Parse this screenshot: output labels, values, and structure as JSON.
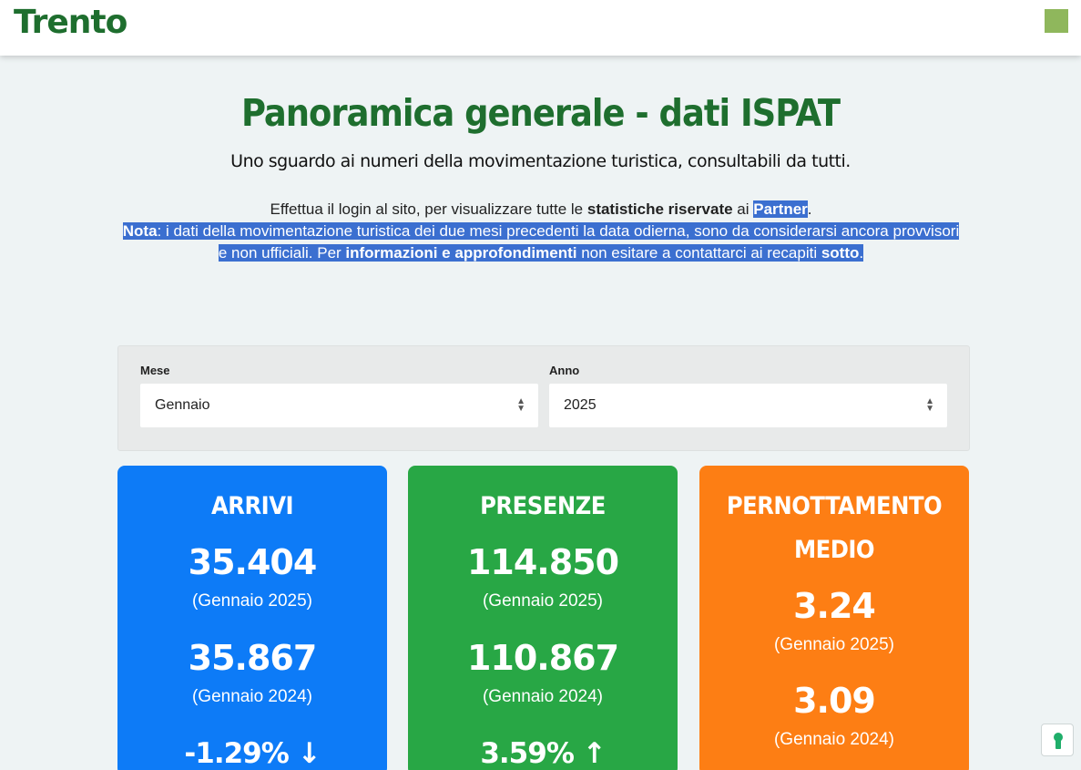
{
  "header": {
    "logo_text": "Trento",
    "menu_color": "#8fb75c"
  },
  "page": {
    "title": "Panoramica generale - dati ISPAT",
    "subtitle": "Uno sguardo ai numeri della movimentazione turistica, consultabili da tutti."
  },
  "info": {
    "line1_pre": "Effettua il login al sito, per visualizzare tutte le ",
    "line1_bold": "statistiche riservate",
    "line1_mid": " ai ",
    "line1_partner": "Partner",
    "line1_end": ".",
    "nota_label": "Nota",
    "nota_text": ": i dati della movimentazione turistica dei due mesi precedenti la data odierna, sono da considerarsi ancora provvisori e non ufficiali. Per ",
    "nota_bold": "informazioni e approfondimenti",
    "nota_text2": " non esitare a contattarci ai recapiti ",
    "nota_sotto": "sotto",
    "nota_end": "."
  },
  "filters": {
    "month_label": "Mese",
    "month_value": "Gennaio",
    "year_label": "Anno",
    "year_value": "2025"
  },
  "cards": {
    "arrivi": {
      "title": "ARRIVI",
      "current_value": "35.404",
      "current_period": "(Gennaio 2025)",
      "previous_value": "35.867",
      "previous_period": "(Gennaio 2024)",
      "delta": "-1.29%",
      "delta_icon": "arrow-down-icon",
      "color": "#0d7bf7"
    },
    "presenze": {
      "title": "PRESENZE",
      "current_value": "114.850",
      "current_period": "(Gennaio 2025)",
      "previous_value": "110.867",
      "previous_period": "(Gennaio 2024)",
      "delta": "3.59%",
      "delta_icon": "arrow-up-icon",
      "color": "#28a745"
    },
    "pernottamento": {
      "title_line1": "PERNOTTAMENTO",
      "title_line2": "MEDIO",
      "current_value": "3.24",
      "current_period": "(Gennaio 2025)",
      "previous_value": "3.09",
      "previous_period": "(Gennaio 2024)",
      "color": "#fd7e14"
    }
  },
  "helper": {
    "icon": "accessibility-helper-icon"
  }
}
